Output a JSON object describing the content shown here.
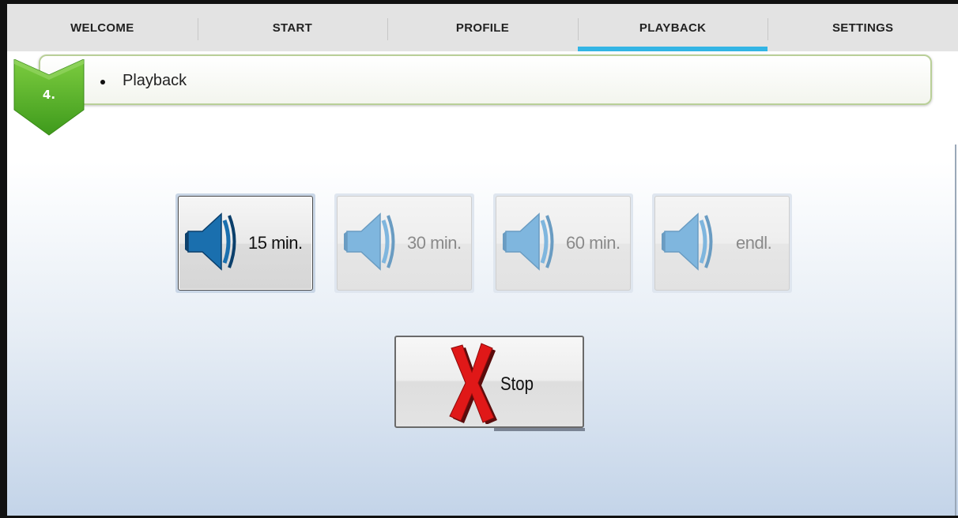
{
  "tabs": [
    {
      "label": "WELCOME",
      "active": false
    },
    {
      "label": "START",
      "active": false
    },
    {
      "label": "PROFILE",
      "active": false
    },
    {
      "label": "PLAYBACK",
      "active": true
    },
    {
      "label": "SETTINGS",
      "active": false
    }
  ],
  "step": {
    "number": "4.",
    "title": "Playback"
  },
  "playback_buttons": [
    {
      "label": "15 min.",
      "selected": true,
      "icon": "speaker-icon"
    },
    {
      "label": "30 min.",
      "selected": false,
      "icon": "speaker-icon"
    },
    {
      "label": "60 min.",
      "selected": false,
      "icon": "speaker-icon"
    },
    {
      "label": "endl.",
      "selected": false,
      "icon": "speaker-icon"
    }
  ],
  "stop_button": {
    "label": "Stop",
    "icon": "red-x-icon"
  },
  "colors": {
    "tab_active_indicator": "#33b5e5",
    "badge_green": "#5fb72a",
    "speaker_active": "#1a6fae",
    "speaker_inactive": "#7fb6de",
    "stop_red": "#e01818"
  }
}
